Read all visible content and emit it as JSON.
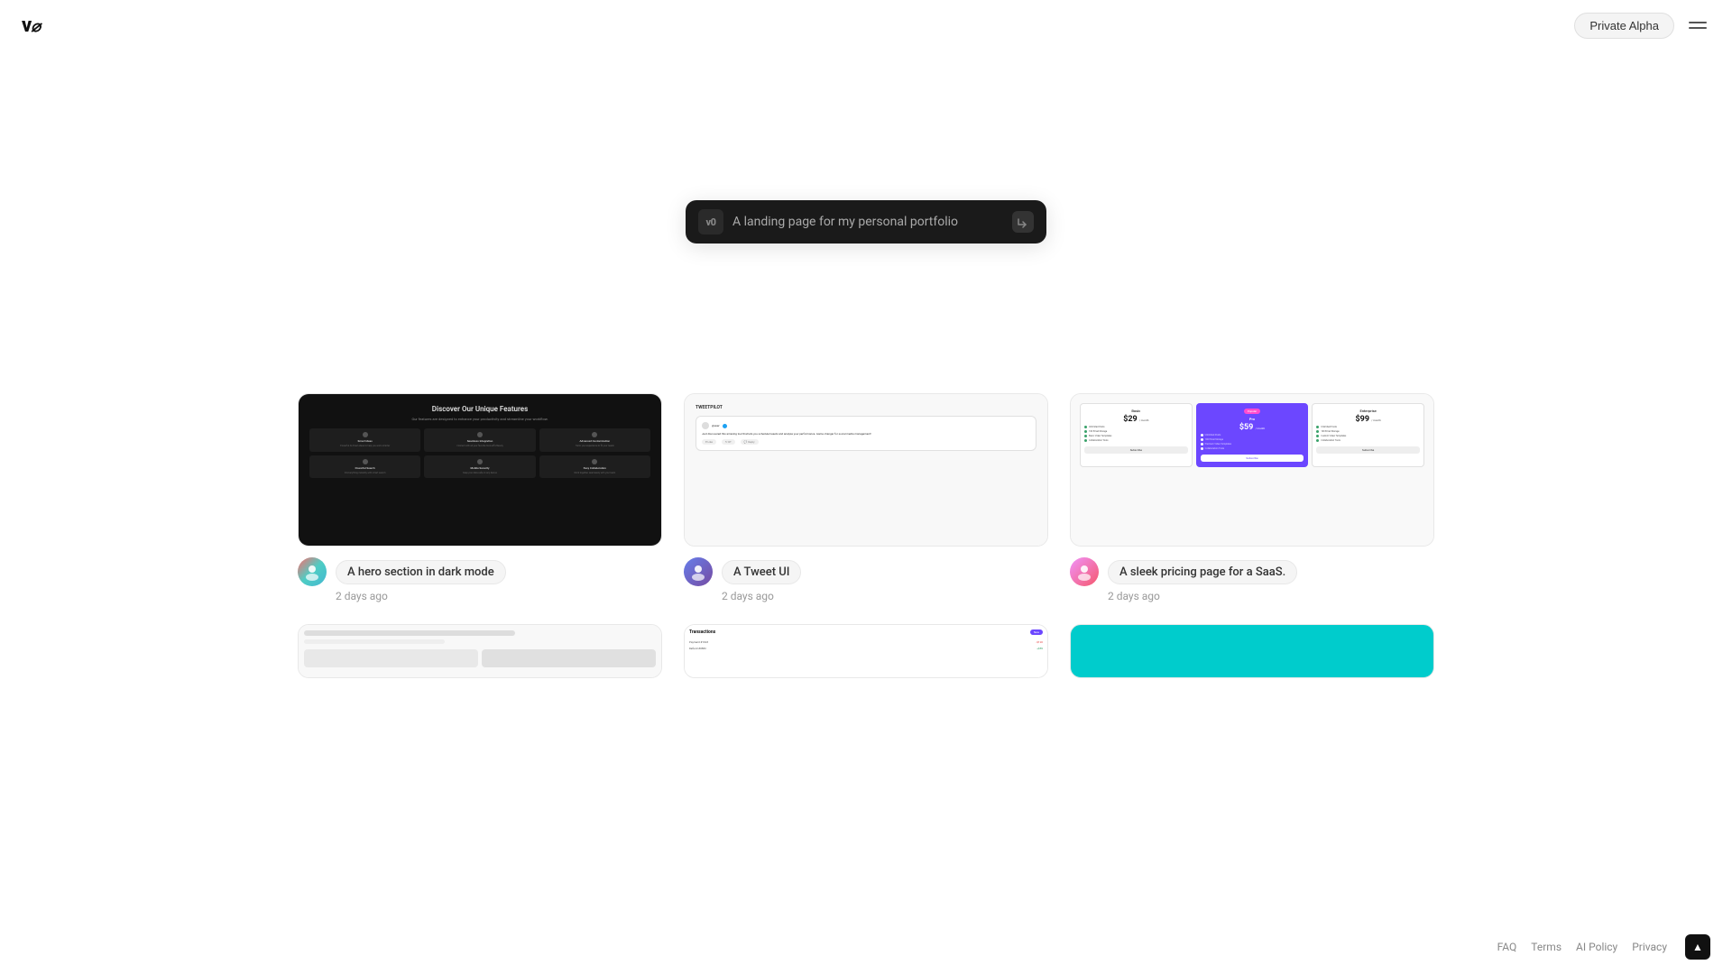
{
  "header": {
    "logo": "v0",
    "badge": "Private Alpha",
    "menu_label": "menu"
  },
  "search": {
    "logo": "v0",
    "placeholder": "A landing page for my personal portfolio",
    "enter_hint": "enter"
  },
  "gallery": {
    "items": [
      {
        "id": "item-1",
        "description": "A hero section in dark mode",
        "timestamp": "2 days ago",
        "avatar_class": "user-avatar-1",
        "avatar_initials": "U",
        "preview_type": "dark-features",
        "preview_title": "Discover Our Unique Features",
        "preview_subtitle": "Our features are designed to enhance your productivity and streamline your workflow.",
        "features": [
          {
            "title": "Smart Ideas",
            "icon_color": "#555"
          },
          {
            "title": "Seamless Integration",
            "icon_color": "#555"
          },
          {
            "title": "Advanced Customization",
            "icon_color": "#555"
          },
          {
            "title": "Powerful Search",
            "icon_color": "#555"
          },
          {
            "title": "Mobile Security",
            "icon_color": "#555"
          },
          {
            "title": "Easy Collaboration",
            "icon_color": "#555"
          }
        ]
      },
      {
        "id": "item-2",
        "description": "A Tweet UI",
        "timestamp": "2 days ago",
        "avatar_class": "user-avatar-2",
        "avatar_initials": "U",
        "preview_type": "tweet",
        "tweet_title": "TWEETPILOT",
        "tweet_text": "Just discovered this amazing tool that lets you schedule tweets and analyze your performance. Game changer for social media management!"
      },
      {
        "id": "item-3",
        "description": "A sleek pricing page for a SaaS.",
        "timestamp": "2 days ago",
        "avatar_class": "user-avatar-3",
        "avatar_initials": "U",
        "preview_type": "pricing",
        "tiers": [
          {
            "name": "Basic",
            "price": "$29",
            "period": "/ month",
            "featured": false,
            "badge": "",
            "features": [
              "Unlimited Posts",
              "100 Email Storage",
              "Basic Video Templates",
              "Collaboration Tools"
            ],
            "btn": "Subscribe",
            "dot_color": "#38a169"
          },
          {
            "name": "Pro",
            "price": "$59",
            "period": "/ month",
            "featured": true,
            "badge": "Popular",
            "features": [
              "Unlimited Posts",
              "100 Email Storage",
              "Premium Video Templates",
              "Collaboration Tools"
            ],
            "btn": "Subscribe",
            "dot_color": "#fff"
          },
          {
            "name": "Enterprise",
            "price": "$99",
            "period": "/ month",
            "featured": false,
            "badge": "",
            "features": [
              "Unlimited Posts",
              "100 Email Storage",
              "Custom Video Templates",
              "Collaboration Tools"
            ],
            "btn": "Subscribe",
            "dot_color": "#38a169"
          }
        ]
      }
    ],
    "partial_items": [
      {
        "id": "item-4",
        "preview_type": "light-partial"
      },
      {
        "id": "item-5",
        "preview_type": "table-partial"
      },
      {
        "id": "item-6",
        "preview_type": "teal-partial"
      }
    ]
  },
  "footer": {
    "links": [
      "FAQ",
      "Terms",
      "AI Policy",
      "Privacy"
    ]
  }
}
